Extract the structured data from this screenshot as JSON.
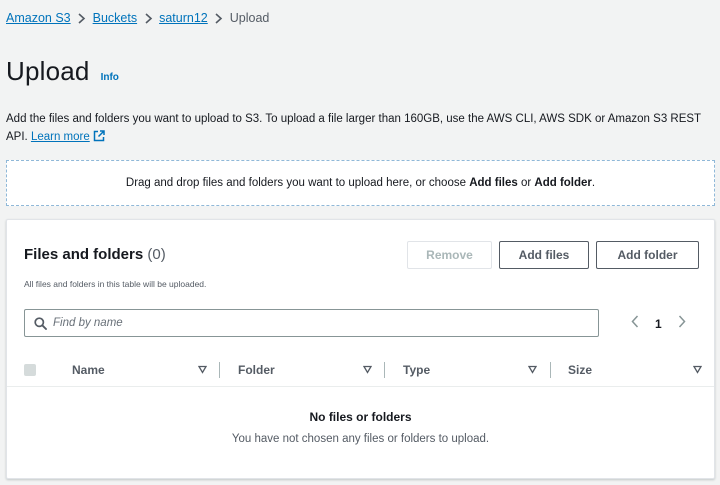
{
  "breadcrumb": {
    "items": [
      "Amazon S3",
      "Buckets",
      "saturn12"
    ],
    "current": "Upload"
  },
  "header": {
    "title": "Upload",
    "info": "Info"
  },
  "description": {
    "text": "Add the files and folders you want to upload to S3. To upload a file larger than 160GB, use the AWS CLI, AWS SDK or Amazon S3 REST API. ",
    "link": "Learn more"
  },
  "dropzone": {
    "prefix": "Drag and drop files and folders you want to upload here, or choose ",
    "add_files": "Add files",
    "or": " or ",
    "add_folder": "Add folder",
    "suffix": "."
  },
  "files_panel": {
    "title": "Files and folders",
    "count": "(0)",
    "subtitle": "All files and folders in this table will be uploaded.",
    "buttons": {
      "remove": "Remove",
      "add_files": "Add files",
      "add_folder": "Add folder"
    },
    "search": {
      "placeholder": "Find by name",
      "value": ""
    },
    "pagination": {
      "page": "1"
    },
    "columns": [
      "Name",
      "Folder",
      "Type",
      "Size"
    ],
    "empty": {
      "title": "No files or folders",
      "description": "You have not chosen any files or folders to upload."
    }
  },
  "colors": {
    "link": "#0073bb",
    "text": "#16191f",
    "muted": "#545b64",
    "disabled": "#aab7b8",
    "background": "#f2f3f3",
    "dropzone_border": "#8fb8d8"
  },
  "icons": {
    "breadcrumb_separator": "chevron-right-icon",
    "external_link": "external-link-icon",
    "search": "search-icon",
    "page_prev": "chevron-left-icon",
    "page_next": "chevron-right-icon",
    "sort": "sort-caret-down-icon"
  }
}
